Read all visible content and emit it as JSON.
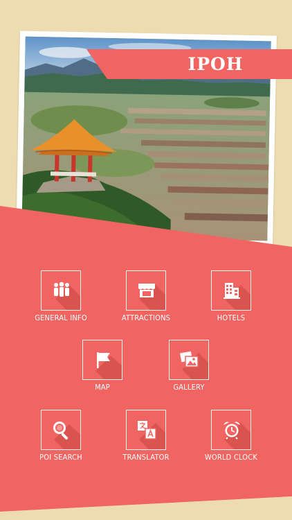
{
  "app": {
    "title": "IPOH"
  },
  "colors": {
    "coral": "#f06562",
    "cream": "#ecdcb0",
    "white": "#ffffff"
  },
  "menu": [
    {
      "id": "general-info",
      "label": "GENERAL INFO",
      "icon": "people-icon"
    },
    {
      "id": "attractions",
      "label": "ATTRACTIONS",
      "icon": "storefront-icon"
    },
    {
      "id": "hotels",
      "label": "HOTELS",
      "icon": "hotel-building-icon"
    },
    {
      "id": "map",
      "label": "MAP",
      "icon": "flag-icon"
    },
    {
      "id": "gallery",
      "label": "GALLERY",
      "icon": "photos-icon"
    },
    {
      "id": "poi-search",
      "label": "POI SEARCH",
      "icon": "magnifier-icon"
    },
    {
      "id": "translator",
      "label": "TRANSLATOR",
      "icon": "translate-icon"
    },
    {
      "id": "world-clock",
      "label": "WORLD CLOCK",
      "icon": "alarm-clock-icon"
    }
  ]
}
